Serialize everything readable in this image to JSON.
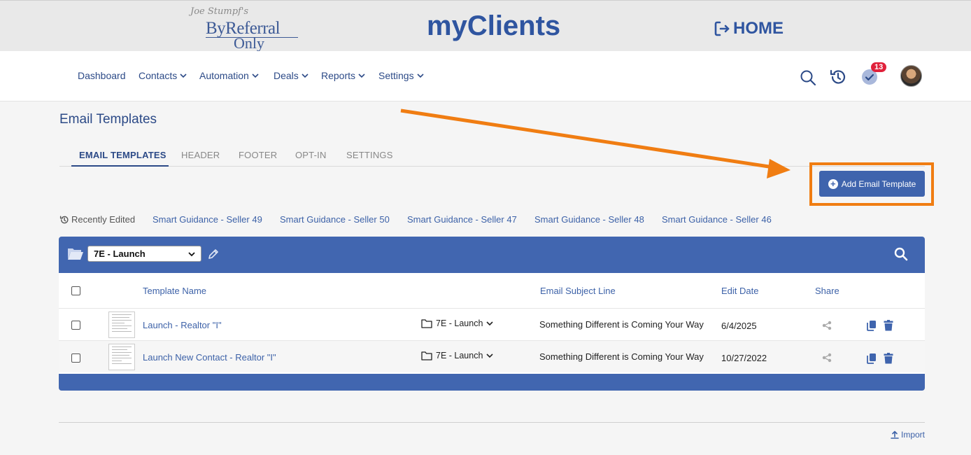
{
  "banner": {
    "logo_script": "Joe Stumpf's",
    "logo_line1": "ByReferral",
    "logo_line2": "Only",
    "app_title": "myClients",
    "home_label": "HOME"
  },
  "nav": {
    "items": [
      "Dashboard",
      "Contacts",
      "Automation",
      "Deals",
      "Reports",
      "Settings"
    ],
    "notification_count": "13"
  },
  "page": {
    "title": "Email Templates",
    "tabs": [
      "EMAIL TEMPLATES",
      "HEADER",
      "FOOTER",
      "OPT-IN",
      "SETTINGS"
    ],
    "active_tab": "EMAIL TEMPLATES",
    "add_button": "Add Email Template"
  },
  "recent": {
    "label": "Recently Edited",
    "links": [
      "Smart Guidance - Seller 49",
      "Smart Guidance - Seller 50",
      "Smart Guidance - Seller 47",
      "Smart Guidance - Seller 48",
      "Smart Guidance - Seller 46"
    ]
  },
  "table": {
    "folder_selected": "7E - Launch",
    "headers": {
      "name": "Template Name",
      "subject": "Email Subject Line",
      "date": "Edit Date",
      "share": "Share"
    },
    "rows": [
      {
        "name": "Launch - Realtor \"I\"",
        "folder": "7E - Launch",
        "subject": "Something Different is Coming Your Way",
        "date": "6/4/2025"
      },
      {
        "name": "Launch New Contact - Realtor \"I\"",
        "folder": "7E - Launch",
        "subject": "Something Different is Coming Your Way",
        "date": "10/27/2022"
      }
    ]
  },
  "footer": {
    "import_label": "Import"
  },
  "colors": {
    "brand_blue": "#2f55a0",
    "panel_blue": "#4166b0",
    "highlight_orange": "#f07d12",
    "badge_red": "#e0213b"
  }
}
